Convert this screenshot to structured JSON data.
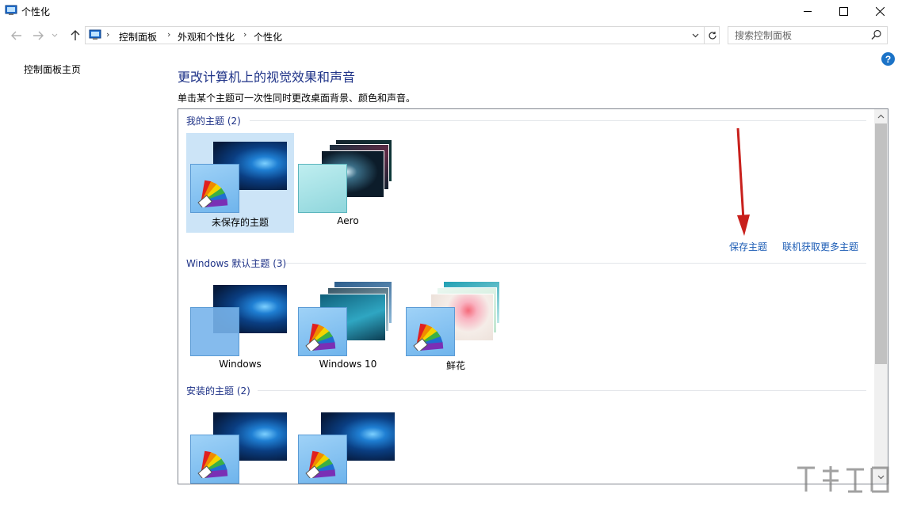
{
  "window": {
    "title": "个性化",
    "min_glyph": "—",
    "max_glyph": "☐",
    "close_glyph": "✕"
  },
  "nav": {
    "breadcrumbs": [
      "控制面板",
      "外观和个性化",
      "个性化"
    ],
    "search_placeholder": "搜索控制面板"
  },
  "left_pane": {
    "home_link": "控制面板主页"
  },
  "main": {
    "title": "更改计算机上的视觉效果和声音",
    "description": "单击某个主题可一次性同时更改桌面背景、颜色和声音。"
  },
  "sections": [
    {
      "heading": "我的主题 (2)",
      "themes": [
        {
          "label": "未保存的主题",
          "selected": true
        },
        {
          "label": "Aero",
          "selected": false
        }
      ],
      "links": [
        "保存主题",
        "联机获取更多主题"
      ]
    },
    {
      "heading": "Windows 默认主题 (3)",
      "themes": [
        {
          "label": "Windows"
        },
        {
          "label": "Windows 10"
        },
        {
          "label": "鲜花"
        }
      ]
    },
    {
      "heading": "安装的主题 (2)",
      "themes": [
        {
          "label": ""
        },
        {
          "label": ""
        }
      ]
    }
  ],
  "colors": {
    "title_blue": "#1e3287",
    "link_blue": "#1c5cb5",
    "selection": "#cce4f7",
    "annotation_arrow": "#c8201c"
  }
}
